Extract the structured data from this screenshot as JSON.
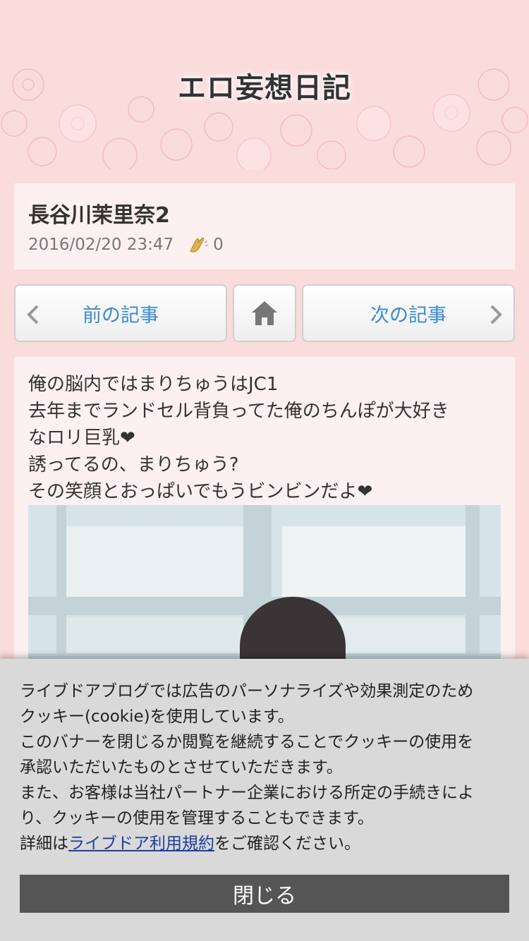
{
  "header": {
    "blog_title": "エロ妄想日記"
  },
  "article": {
    "title": "長谷川茉里奈2",
    "datetime": "2016/02/20 23:47",
    "clap_count": "0",
    "body_lines": [
      "俺の脳内ではまりちゅうはJC1",
      "去年までランドセル背負ってた俺のちんぽが大好き",
      "なロリ巨乳❤",
      "誘ってるの、まりちゅう?",
      "その笑顔とおっぱいでもうビンビンだよ❤"
    ]
  },
  "nav": {
    "prev_label": "前の記事",
    "next_label": "次の記事"
  },
  "cookie": {
    "lines": [
      "ライブドアブログでは広告のパーソナライズや効果測定のため",
      "クッキー(cookie)を使用しています。",
      "このバナーを閉じるか閲覧を継続することでクッキーの使用を",
      "承認いただいたものとさせていただきます。",
      "また、お客様は当社パートナー企業における所定の手続きによ",
      "り、クッキーの使用を管理することもできます。"
    ],
    "detail_prefix": "詳細は",
    "link_text": "ライブドア利用規約",
    "detail_suffix": "をご確認ください。",
    "close_label": "閉じる"
  },
  "colors": {
    "background": "#fadcdc",
    "card": "#fdf0f0",
    "link": "#3a8ad0",
    "banner": "#d9d9d9",
    "close_button": "#555555"
  },
  "icons": [
    "chevron-left-icon",
    "home-icon",
    "chevron-right-icon",
    "clap-icon"
  ]
}
